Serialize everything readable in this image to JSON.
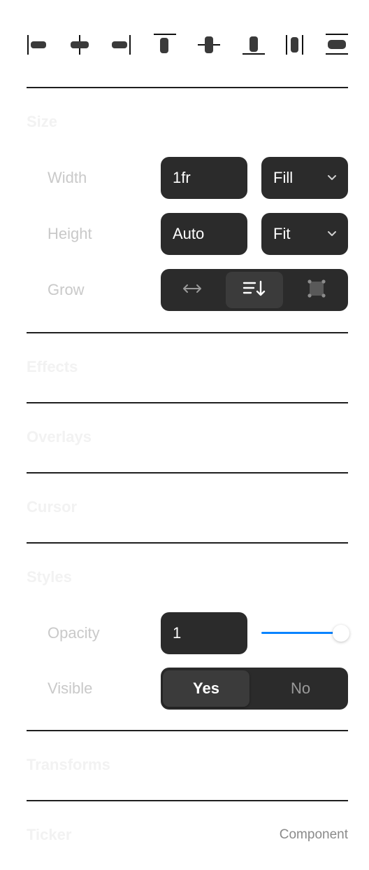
{
  "alignment": {
    "buttons": [
      "align-left",
      "align-center-horizontal",
      "align-right",
      "align-top",
      "align-center-vertical",
      "align-bottom",
      "distribute-horizontal",
      "distribute-vertical"
    ]
  },
  "sections": {
    "size": {
      "title": "Size"
    },
    "effects": {
      "title": "Effects"
    },
    "overlays": {
      "title": "Overlays"
    },
    "cursor": {
      "title": "Cursor"
    },
    "styles": {
      "title": "Styles"
    },
    "transforms": {
      "title": "Transforms"
    },
    "ticker": {
      "title": "Ticker",
      "link": "Component"
    }
  },
  "size": {
    "width": {
      "label": "Width",
      "value": "1fr",
      "mode": "Fill"
    },
    "height": {
      "label": "Height",
      "value": "Auto",
      "mode": "Fit"
    },
    "grow": {
      "label": "Grow",
      "options": [
        "horizontal",
        "vertical",
        "both"
      ],
      "selected": "vertical"
    }
  },
  "styles": {
    "opacity": {
      "label": "Opacity",
      "value": "1",
      "slider": 1.0
    },
    "visible": {
      "label": "Visible",
      "yes": "Yes",
      "no": "No",
      "selected": "Yes"
    }
  },
  "colors": {
    "accent": "#0a84ff",
    "field": "#2b2b2b",
    "divider": "#1f1f1f"
  }
}
